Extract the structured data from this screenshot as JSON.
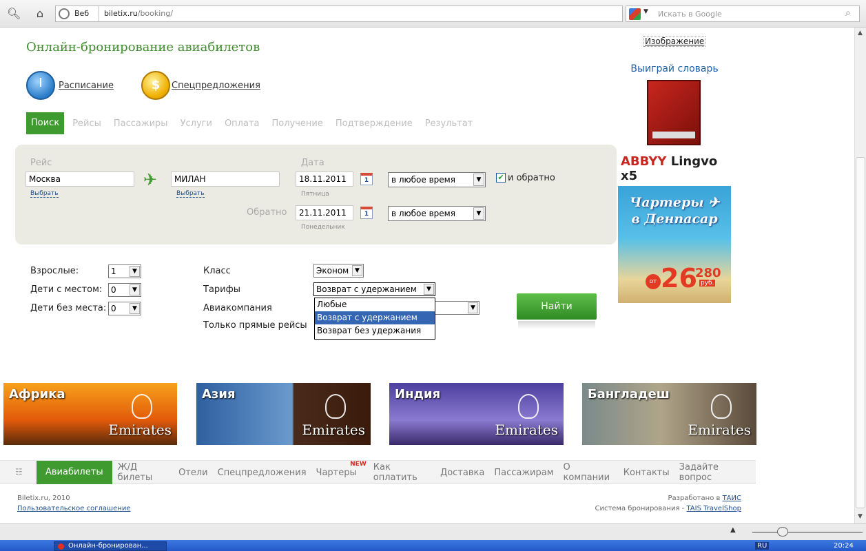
{
  "browser": {
    "search_engine_label": "Веб",
    "url_host": "biletix.ru",
    "url_path": "/booking/",
    "search_placeholder": "Искать в Google"
  },
  "page": {
    "title": "Онлайн-бронирование авиабилетов",
    "links": {
      "schedule": "Расписание",
      "special": "Спецпредложения"
    }
  },
  "steps": [
    {
      "label": "Поиск",
      "active": true
    },
    {
      "label": "Рейсы"
    },
    {
      "label": "Пассажиры"
    },
    {
      "label": "Услуги"
    },
    {
      "label": "Оплата"
    },
    {
      "label": "Получение"
    },
    {
      "label": "Подтверждение"
    },
    {
      "label": "Результат"
    }
  ],
  "search": {
    "flight_label": "Рейс",
    "date_label": "Дата",
    "from_value": "Москва",
    "to_value": "МИЛАН",
    "choose_label": "Выбрать",
    "depart_date": "18.11.2011",
    "depart_day": "Пятница",
    "depart_time": "в любое время",
    "return_label": "Обратно",
    "return_date": "21.11.2011",
    "return_day": "Понедельник",
    "return_time": "в любое время",
    "roundtrip_label": "и обратно",
    "calendar_glyph": "1"
  },
  "passengers": {
    "adults_label": "Взрослые:",
    "adults_value": "1",
    "children_label": "Дети с местом:",
    "children_value": "0",
    "infants_label": "Дети без места:",
    "infants_value": "0",
    "class_label": "Класс",
    "class_value": "Эконом",
    "tariff_label": "Тарифы",
    "tariff_value": "Возврат с удержанием",
    "airline_label": "Авиакомпания",
    "direct_label": "Только прямые рейсы",
    "tariff_options": [
      "Любые",
      "Возврат с удержанием",
      "Возврат без удержания"
    ],
    "find_button": "Найти"
  },
  "sidebar": {
    "image_label": "Изображение",
    "abbyy_title": "Выиграй словарь",
    "abbyy_brand": "ABBYY",
    "abbyy_product": "Lingvo",
    "abbyy_version": "x5",
    "charter_title_1": "Чартеры",
    "charter_title_2": "в Денпасар",
    "price_prefix": "от",
    "price_big": "26",
    "price_small": "280",
    "price_currency": "руб."
  },
  "banners": [
    {
      "name": "Африка",
      "brand": "Emirates"
    },
    {
      "name": "Азия",
      "brand": "Emirates"
    },
    {
      "name": "Индия",
      "brand": "Emirates"
    },
    {
      "name": "Бангладеш",
      "brand": "Emirates"
    }
  ],
  "nav": [
    {
      "label": "Авиабилеты",
      "active": true
    },
    {
      "label": "Ж/Д билеты"
    },
    {
      "label": "Отели"
    },
    {
      "label": "Спецпредложения"
    },
    {
      "label": "Чартеры",
      "badge": "NEW"
    },
    {
      "label": "Как оплатить"
    },
    {
      "label": "Доставка"
    },
    {
      "label": "Пассажирам"
    },
    {
      "label": "О компании"
    },
    {
      "label": "Контакты"
    },
    {
      "label": "Задайте вопрос"
    }
  ],
  "footer": {
    "copyright": "Biletix.ru, 2010",
    "agreement": "Пользовательское соглашение",
    "developed_prefix": "Разработано в",
    "developer": "ТАИС",
    "system_prefix": "Система бронирования -",
    "system": "TAIS TravelShop"
  },
  "taskbar": {
    "app_title": "Онлайн-бронирован...",
    "lang": "RU",
    "clock": "20:24"
  }
}
